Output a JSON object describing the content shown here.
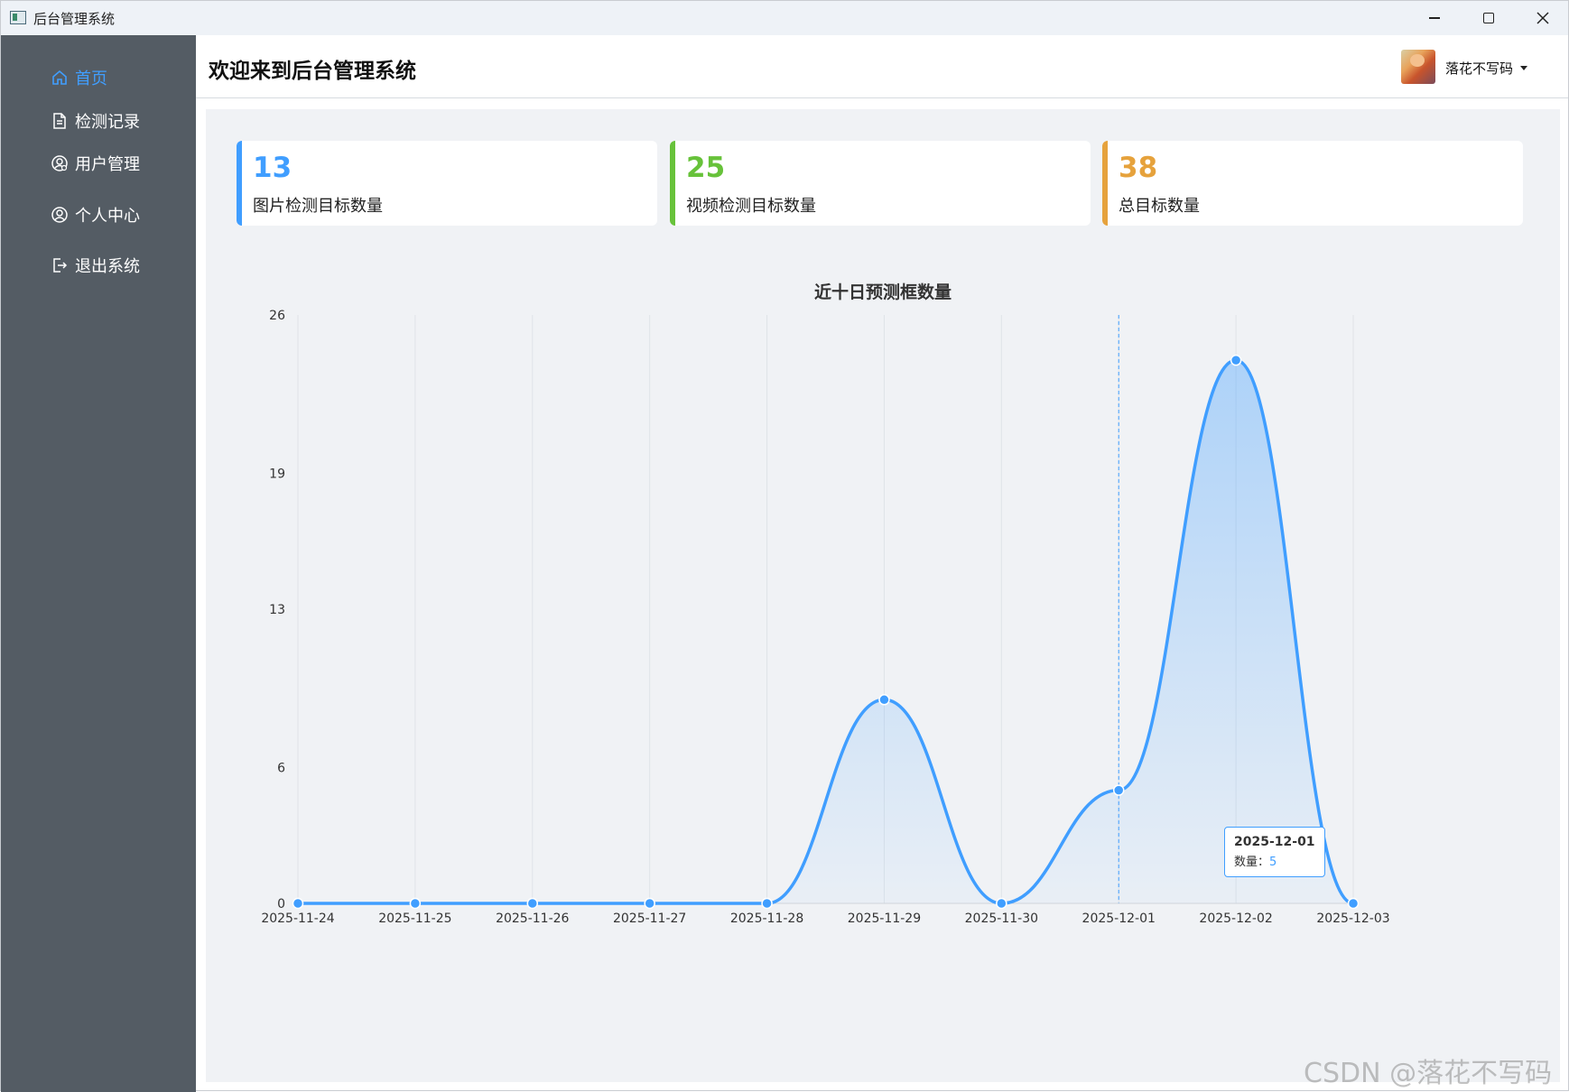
{
  "window": {
    "title": "后台管理系统"
  },
  "sidebar": {
    "items": [
      {
        "label": "首页",
        "icon": "home-icon",
        "active": true
      },
      {
        "label": "检测记录",
        "icon": "document-icon",
        "active": false
      },
      {
        "label": "用户管理",
        "icon": "user-manage-icon",
        "active": false
      },
      {
        "label": "个人中心",
        "icon": "user-circle-icon",
        "active": false
      },
      {
        "label": "退出系统",
        "icon": "logout-icon",
        "active": false
      }
    ]
  },
  "header": {
    "title": "欢迎来到后台管理系统",
    "username": "落花不写码"
  },
  "cards": [
    {
      "value": "13",
      "label": "图片检测目标数量",
      "color": "#409eff"
    },
    {
      "value": "25",
      "label": "视频检测目标数量",
      "color": "#67c23a"
    },
    {
      "value": "38",
      "label": "总目标数量",
      "color": "#e6a23c"
    }
  ],
  "tooltip": {
    "date": "2025-12-01",
    "label": "数量：",
    "value": "5"
  },
  "watermark": "CSDN @落花不写码",
  "chart_data": {
    "type": "area",
    "title": "近十日预测框数量",
    "categories": [
      "2025-11-24",
      "2025-11-25",
      "2025-11-26",
      "2025-11-27",
      "2025-11-28",
      "2025-11-29",
      "2025-11-30",
      "2025-12-01",
      "2025-12-02",
      "2025-12-03"
    ],
    "values": [
      0,
      0,
      0,
      0,
      0,
      9,
      0,
      5,
      24,
      0
    ],
    "y_ticks": [
      "0",
      "6",
      "13",
      "19",
      "26"
    ],
    "ylim": [
      0,
      26
    ],
    "series_color": "#409eff",
    "grid": "vertical",
    "smooth": true
  }
}
